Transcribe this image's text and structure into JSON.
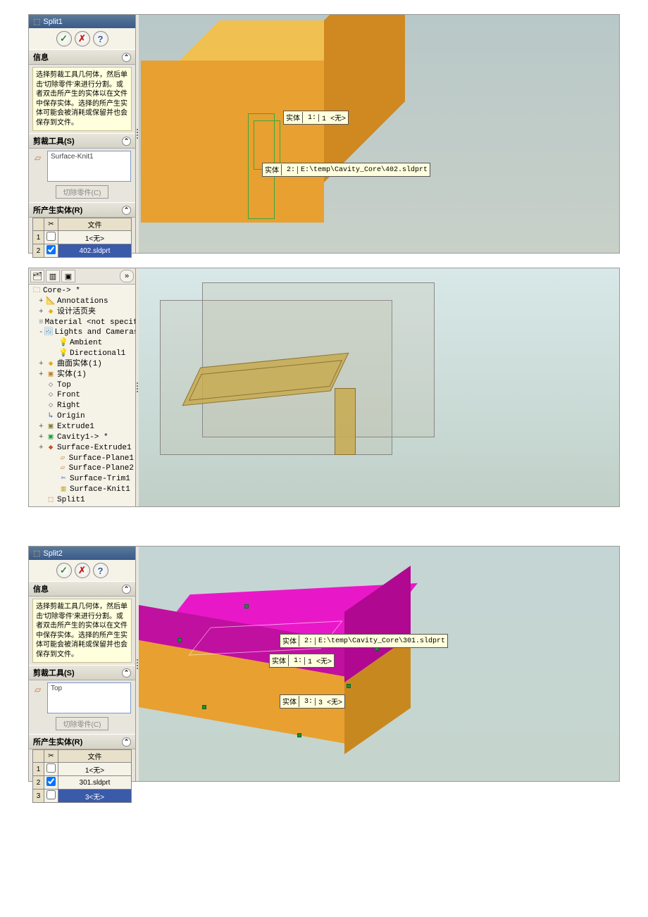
{
  "shot1": {
    "title": "Split1",
    "info_hdr": "信息",
    "info_text": "选择剪裁工具几何体，然后单击'切除零件'来进行分割。或者双击所产生的实体以在文件中保存实体。选择的所产生实体可能会被消耗或保留并也会保存到文件。",
    "trim_hdr": "剪裁工具(S)",
    "trim_value": "Surface-Knit1",
    "cut_btn": "切除零件(C)",
    "result_hdr": "所产生实体(R)",
    "col_cut": "✂",
    "col_file": "文件",
    "rows": [
      {
        "idx": "1",
        "checked": false,
        "file": "1<无>"
      },
      {
        "idx": "2",
        "checked": true,
        "file": "402.sldprt"
      }
    ],
    "callout1": {
      "label": "实体",
      "idx": "1:",
      "text": "1 <无>"
    },
    "callout2": {
      "label": "实体",
      "idx": "2:",
      "text": "E:\\temp\\Cavity_Core\\402.sldprt"
    }
  },
  "shot2": {
    "root": "Core-> *",
    "items": [
      {
        "lvl": 1,
        "exp": "+",
        "ic": "📐",
        "txt": "Annotations",
        "color": "#c8a020"
      },
      {
        "lvl": 1,
        "exp": "+",
        "ic": "◆",
        "txt": "设计活页夹",
        "color": "#e0b000"
      },
      {
        "lvl": 1,
        "exp": "",
        "ic": "≡",
        "txt": "Material <not specifi",
        "color": "#888"
      },
      {
        "lvl": 1,
        "exp": "-",
        "ic": "🖼",
        "txt": "Lights and Cameras",
        "color": "#60a0d0"
      },
      {
        "lvl": 2,
        "exp": "",
        "ic": "💡",
        "txt": "Ambient",
        "color": "#e0c000"
      },
      {
        "lvl": 2,
        "exp": "",
        "ic": "💡",
        "txt": "Directional1",
        "color": "#e0c000"
      },
      {
        "lvl": 1,
        "exp": "+",
        "ic": "◆",
        "txt": "曲面实体(1)",
        "color": "#e0b000"
      },
      {
        "lvl": 1,
        "exp": "+",
        "ic": "▣",
        "txt": "实体(1)",
        "color": "#c08020"
      },
      {
        "lvl": 1,
        "exp": "",
        "ic": "◇",
        "txt": "Top",
        "color": "#888"
      },
      {
        "lvl": 1,
        "exp": "",
        "ic": "◇",
        "txt": "Front",
        "color": "#888"
      },
      {
        "lvl": 1,
        "exp": "",
        "ic": "◇",
        "txt": "Right",
        "color": "#888"
      },
      {
        "lvl": 1,
        "exp": "",
        "ic": "↳",
        "txt": "Origin",
        "color": "#3060c0"
      },
      {
        "lvl": 1,
        "exp": "+",
        "ic": "▣",
        "txt": "Extrude1",
        "color": "#808030"
      },
      {
        "lvl": 1,
        "exp": "+",
        "ic": "▣",
        "txt": "Cavity1-> *",
        "color": "#20a040"
      },
      {
        "lvl": 1,
        "exp": "+",
        "ic": "◆",
        "txt": "Surface-Extrude1",
        "color": "#d05020"
      },
      {
        "lvl": 2,
        "exp": "",
        "ic": "▱",
        "txt": "Surface-Plane1",
        "color": "#d08030"
      },
      {
        "lvl": 2,
        "exp": "",
        "ic": "▱",
        "txt": "Surface-Plane2",
        "color": "#d08030"
      },
      {
        "lvl": 2,
        "exp": "",
        "ic": "✂",
        "txt": "Surface-Trim1",
        "color": "#4060c0"
      },
      {
        "lvl": 2,
        "exp": "",
        "ic": "▥",
        "txt": "Surface-Knit1",
        "color": "#c0a030"
      },
      {
        "lvl": 1,
        "exp": "",
        "ic": "⬚",
        "txt": "Split1",
        "color": "#c07020"
      }
    ]
  },
  "shot3": {
    "title": "Split2",
    "info_hdr": "信息",
    "info_text": "选择剪裁工具几何体，然后单击'切除零件'来进行分割。或者双击所产生的实体以在文件中保存实体。选择的所产生实体可能会被消耗或保留并也会保存到文件。",
    "trim_hdr": "剪裁工具(S)",
    "trim_value": "Top",
    "cut_btn": "切除零件(C)",
    "result_hdr": "所产生实体(R)",
    "col_cut": "✂",
    "col_file": "文件",
    "rows": [
      {
        "idx": "1",
        "checked": false,
        "file": "1<无>"
      },
      {
        "idx": "2",
        "checked": true,
        "file": "301.sldprt"
      },
      {
        "idx": "3",
        "checked": false,
        "file": "3<无>"
      }
    ],
    "callout1": {
      "label": "实体",
      "idx": "1:",
      "text": "1 <无>"
    },
    "callout2": {
      "label": "实体",
      "idx": "2:",
      "text": "E:\\temp\\Cavity_Core\\301.sldprt"
    },
    "callout3": {
      "label": "实体",
      "idx": "3:",
      "text": "3 <无>"
    }
  }
}
